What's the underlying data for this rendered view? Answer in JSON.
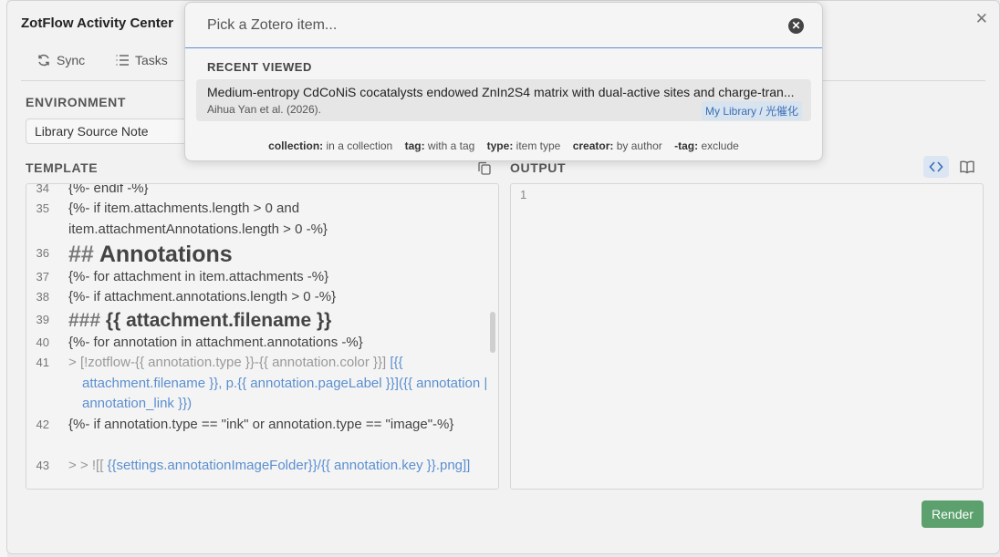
{
  "window": {
    "title": "ZotFlow Activity Center",
    "close_glyph": "✕"
  },
  "tabs": [
    {
      "label": "Sync",
      "icon": "refresh-icon"
    },
    {
      "label": "Tasks",
      "icon": "list-icon"
    }
  ],
  "environment": {
    "label": "ENVIRONMENT",
    "value": "Library Source Note"
  },
  "template": {
    "label": "TEMPLATE",
    "lines": [
      {
        "num": "34",
        "text": "{%- endif -%}"
      },
      {
        "num": "35",
        "text": "{%- if item.attachments.length > 0 and item.attachmentAnnotations.length > 0 -%}"
      },
      {
        "num": "36",
        "hash": "##",
        "text": "Annotations"
      },
      {
        "num": "37",
        "text": "{%- for attachment in item.attachments -%}"
      },
      {
        "num": "38",
        "text": "{%- if attachment.annotations.length > 0 -%}"
      },
      {
        "num": "39",
        "hash": "###",
        "text": "{{ attachment.filename }}"
      },
      {
        "num": "40",
        "text": "{%- for annotation in attachment.annotations -%}"
      },
      {
        "num": "41",
        "gt": ">",
        "mute": "[!zotflow-{{ annotation.type }}-{{ annotation.color }}]",
        "text": "[{{ attachment.filename }}, p.{{ annotation.pageLabel }}]({{ annotation | annotation_link }})"
      },
      {
        "num": "42",
        "text": "{%- if annotation.type == \"ink\" or annotation.type == \"image\"-%}"
      },
      {
        "num": "43",
        "gt": "> > ![[",
        "text": "{{settings.annotationImageFolder}}/{{ annotation.key }}.png]]"
      }
    ]
  },
  "output": {
    "label": "OUTPUT",
    "line_number": "1",
    "buttons": [
      {
        "name": "code-view-icon",
        "active": true
      },
      {
        "name": "book-preview-icon",
        "active": false
      }
    ]
  },
  "render_button": "Render",
  "picker": {
    "placeholder": "Pick a Zotero item...",
    "clear_glyph": "✕",
    "recent_label": "RECENT VIEWED",
    "recent_items": [
      {
        "title": "Medium-entropy CdCoNiS cocatalysts endowed ZnIn2S4 matrix with dual-active sites and charge-tran...",
        "author": "Aihua Yan et al. (2026).",
        "library": "My Library / 光催化"
      }
    ],
    "hints": [
      {
        "key": "collection:",
        "desc": "in a collection"
      },
      {
        "key": "tag:",
        "desc": "with a tag"
      },
      {
        "key": "type:",
        "desc": "item type"
      },
      {
        "key": "creator:",
        "desc": "by author"
      },
      {
        "key": "-tag:",
        "desc": "exclude"
      }
    ]
  },
  "colors": {
    "accent": "#5b8fd0",
    "render_green": "#5ba06d"
  }
}
